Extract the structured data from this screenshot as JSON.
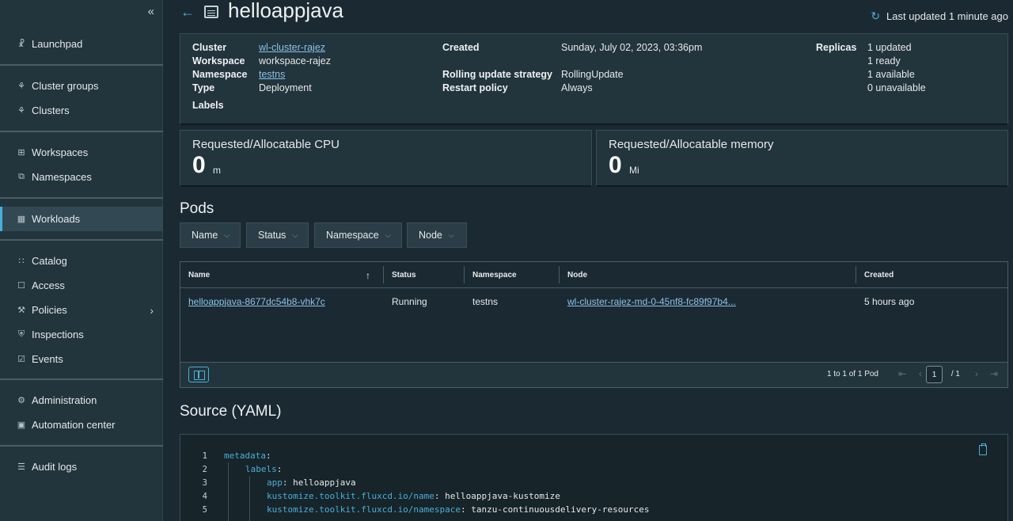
{
  "sidebar": {
    "collapse_icon": "«",
    "items": [
      {
        "label": "Launchpad",
        "icon": "launchpad-icon"
      },
      {
        "label": "Cluster groups",
        "icon": "cluster-groups-icon"
      },
      {
        "label": "Clusters",
        "icon": "clusters-icon"
      },
      {
        "label": "Workspaces",
        "icon": "workspaces-icon"
      },
      {
        "label": "Namespaces",
        "icon": "namespaces-icon"
      },
      {
        "label": "Workloads",
        "icon": "workloads-icon",
        "active": true
      },
      {
        "label": "Catalog",
        "icon": "catalog-icon"
      },
      {
        "label": "Access",
        "icon": "access-icon"
      },
      {
        "label": "Policies",
        "icon": "policies-icon"
      },
      {
        "label": "Inspections",
        "icon": "inspections-icon"
      },
      {
        "label": "Events",
        "icon": "events-icon"
      },
      {
        "label": "Administration",
        "icon": "administration-icon"
      },
      {
        "label": "Automation center",
        "icon": "automation-center-icon"
      },
      {
        "label": "Audit logs",
        "icon": "audit-logs-icon"
      }
    ]
  },
  "header": {
    "title": "helloappjava",
    "last_updated": "Last updated 1 minute ago"
  },
  "info": {
    "cluster_label": "Cluster",
    "cluster_value": "wl-cluster-rajez",
    "workspace_label": "Workspace",
    "workspace_value": "workspace-rajez",
    "namespace_label": "Namespace",
    "namespace_value": "testns",
    "type_label": "Type",
    "type_value": "Deployment",
    "labels_label": "Labels",
    "created_label": "Created",
    "created_value": "Sunday, July 02, 2023, 03:36pm",
    "strategy_label": "Rolling update strategy",
    "strategy_value": "RollingUpdate",
    "restart_label": "Restart policy",
    "restart_value": "Always",
    "replicas_label": "Replicas",
    "replicas_updated": "1 updated",
    "replicas_ready": "1 ready",
    "replicas_available": "1 available",
    "replicas_unavailable": "0 unavailable"
  },
  "cpu": {
    "label": "Requested/Allocatable CPU",
    "value": "0",
    "unit": "m"
  },
  "memory": {
    "label": "Requested/Allocatable memory",
    "value": "0",
    "unit": "Mi"
  },
  "pods": {
    "title": "Pods",
    "filters": [
      "Name",
      "Status",
      "Namespace",
      "Node"
    ],
    "columns": [
      "Name",
      "Status",
      "Namespace",
      "Node",
      "Created"
    ],
    "rows": [
      {
        "name": "helloappjava-8677dc54b8-vhk7c",
        "status": "Running",
        "namespace": "testns",
        "node": "wl-cluster-rajez-md-0-45nf8-fc89f97b4...",
        "created": "5 hours ago"
      }
    ],
    "pagination_text": "1 to 1 of 1 Pod",
    "page_current": "1",
    "page_total": "/ 1"
  },
  "yaml": {
    "title": "Source (YAML)",
    "lines": [
      {
        "n": "1",
        "key": "metadata",
        "val": ""
      },
      {
        "n": "2",
        "key": "labels",
        "val": ""
      },
      {
        "n": "3",
        "key": "app",
        "val": "helloappjava"
      },
      {
        "n": "4",
        "key": "kustomize.toolkit.fluxcd.io/name",
        "val": "helloappjava-kustomize"
      },
      {
        "n": "5",
        "key": "kustomize.toolkit.fluxcd.io/namespace",
        "val": "tanzu-continuousdelivery-resources"
      }
    ]
  }
}
